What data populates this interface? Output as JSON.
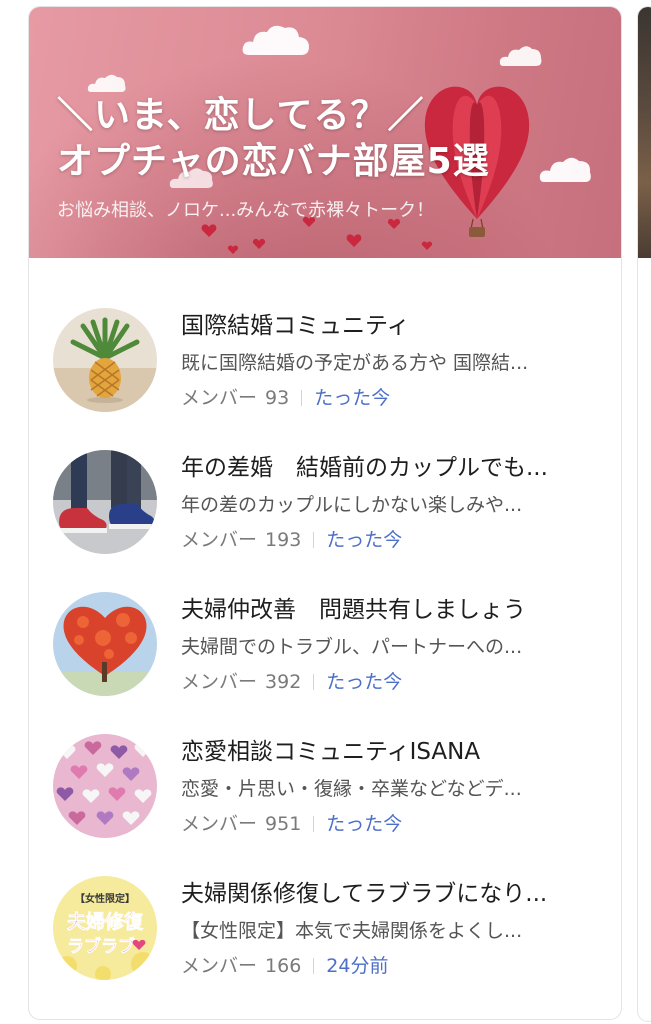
{
  "banner": {
    "title_line1": "＼いま、恋してる？／",
    "title_line2": "オプチャの恋バナ部屋5選",
    "subtitle": "お悩み相談、ノロケ...みんなで赤裸々トーク！",
    "colors": {
      "bg": "#dc8b95",
      "heart": "#c9283f"
    }
  },
  "rooms": [
    {
      "title": "国際結婚コミュニティ",
      "description": "既に国際結婚の予定がある方や 国際結...",
      "member_label": "メンバー",
      "member_count": "93",
      "last_active": "たった今",
      "avatar_icon": "pineapple-image"
    },
    {
      "title": "年の差婚　結婚前のカップルでも...",
      "description": "年の差のカップルにしかない楽しみや...",
      "member_label": "メンバー",
      "member_count": "193",
      "last_active": "たった今",
      "avatar_icon": "couple-shoes-image"
    },
    {
      "title": "夫婦仲改善　問題共有しましょう",
      "description": "夫婦間でのトラブル、パートナーへの...",
      "member_label": "メンバー",
      "member_count": "392",
      "last_active": "たった今",
      "avatar_icon": "heart-tree-image"
    },
    {
      "title": "恋愛相談コミュニティISANA",
      "description": "恋愛・片思い・復縁・卒業などなどデ...",
      "member_label": "メンバー",
      "member_count": "951",
      "last_active": "たった今",
      "avatar_icon": "heart-candies-image"
    },
    {
      "title": "夫婦関係修復してラブラブになり...",
      "description": "【女性限定】本気で夫婦関係をよくし...",
      "member_label": "メンバー",
      "member_count": "166",
      "last_active": "24分前",
      "avatar_icon": "women-only-badge-image",
      "avatar_text": {
        "line1": "【女性限定】",
        "line2": "夫婦修復",
        "line3": "ラブラブ"
      }
    }
  ],
  "theme": {
    "link_color": "#4c6fc7",
    "meta_color": "#7a7a7a",
    "title_color": "#1e1e1e"
  }
}
